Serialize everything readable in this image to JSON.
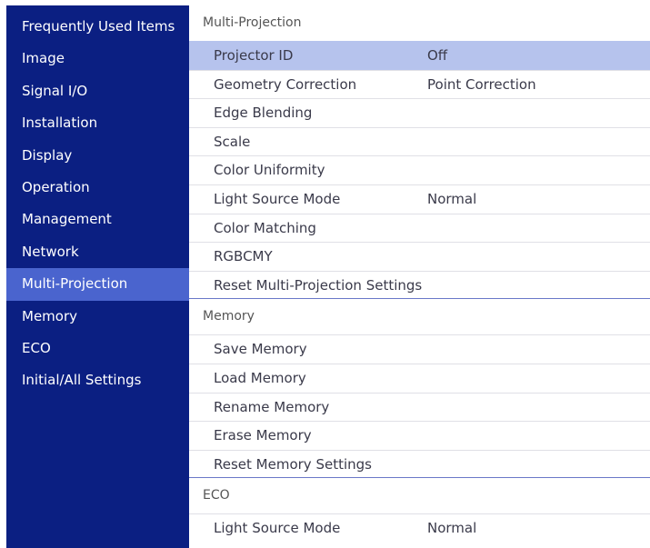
{
  "sidebar": {
    "items": [
      {
        "label": "Frequently Used Items"
      },
      {
        "label": "Image"
      },
      {
        "label": "Signal I/O"
      },
      {
        "label": "Installation"
      },
      {
        "label": "Display"
      },
      {
        "label": "Operation"
      },
      {
        "label": "Management"
      },
      {
        "label": "Network"
      },
      {
        "label": "Multi-Projection",
        "selected": true
      },
      {
        "label": "Memory"
      },
      {
        "label": "ECO"
      },
      {
        "label": "Initial/All Settings"
      }
    ]
  },
  "main": {
    "multi_projection": {
      "header": "Multi-Projection",
      "rows": [
        {
          "label": "Projector ID",
          "value": "Off"
        },
        {
          "label": "Geometry Correction",
          "value": "Point Correction"
        },
        {
          "label": "Edge Blending",
          "value": ""
        },
        {
          "label": "Scale",
          "value": ""
        },
        {
          "label": "Color Uniformity",
          "value": ""
        },
        {
          "label": "Light Source Mode",
          "value": "Normal"
        },
        {
          "label": "Color Matching",
          "value": ""
        },
        {
          "label": "RGBCMY",
          "value": ""
        },
        {
          "label": "Reset Multi-Projection Settings",
          "value": ""
        }
      ]
    },
    "memory": {
      "header": "Memory",
      "rows": [
        {
          "label": "Save Memory"
        },
        {
          "label": "Load Memory"
        },
        {
          "label": "Rename Memory"
        },
        {
          "label": "Erase Memory"
        },
        {
          "label": "Reset Memory Settings"
        }
      ]
    },
    "eco": {
      "header": "ECO",
      "rows": [
        {
          "label": "Light Source Mode",
          "value": "Normal"
        }
      ]
    }
  }
}
